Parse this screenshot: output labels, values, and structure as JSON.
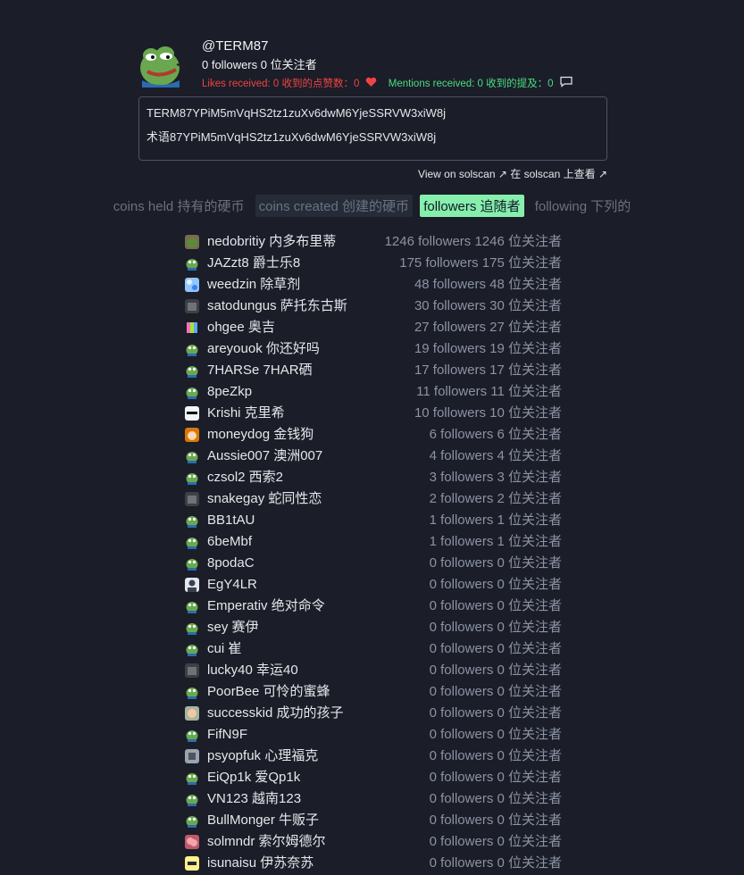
{
  "profile": {
    "handle": "@TERM87",
    "followers_text": "0 followers 0 位关注者",
    "likes_text": "Likes received: 0  收到的点赞数：0",
    "mentions_text": "Mentions received: 0  收到的提及：0",
    "address_en": "TERM87YPiM5mVqHS2tz1zuXv6dwM6YjeSSRVW3xiW8j",
    "address_cn": "术语87YPiM5mVqHS2tz1zuXv6dwM6YjeSSRVW3xiW8j",
    "solscan_text": "View on solscan ↗ 在 solscan 上查看 ↗"
  },
  "tabs": [
    {
      "label": "coins held 持有的硬币",
      "state": "inactive"
    },
    {
      "label": "coins created 创建的硬币",
      "state": "muted"
    },
    {
      "label": "followers 追随者",
      "state": "active"
    },
    {
      "label": "following 下列的",
      "state": "inactive"
    }
  ],
  "followers": [
    {
      "name": "nedobritiy  内多布里蒂",
      "count": "1246 followers 1246 位关注者",
      "icon": "pepe-photo"
    },
    {
      "name": "JAZzt8  爵士乐8",
      "count": "175 followers 175 位关注者",
      "icon": "pepe"
    },
    {
      "name": "weedzin  除草剂",
      "count": "48 followers 48 位关注者",
      "icon": "blue-pattern"
    },
    {
      "name": "satodungus  萨托东古斯",
      "count": "30 followers 30 位关注者",
      "icon": "dark-photo"
    },
    {
      "name": "ohgee  奥吉",
      "count": "27 followers 27 位关注者",
      "icon": "colorful"
    },
    {
      "name": "areyouok  你还好吗",
      "count": "19 followers 19 位关注者",
      "icon": "pepe"
    },
    {
      "name": "7HARSe  7HAR硒",
      "count": "17 followers 17 位关注者",
      "icon": "pepe"
    },
    {
      "name": "8peZkp",
      "count": "11 followers 11 位关注者",
      "icon": "pepe"
    },
    {
      "name": "Krishi  克里希",
      "count": "10 followers 10 位关注者",
      "icon": "white-face"
    },
    {
      "name": "moneydog  金钱狗",
      "count": "6 followers 6 位关注者",
      "icon": "dog"
    },
    {
      "name": "Aussie007  澳洲007",
      "count": "4 followers 4 位关注者",
      "icon": "pepe"
    },
    {
      "name": "czsol2  西索2",
      "count": "3 followers 3 位关注者",
      "icon": "pepe"
    },
    {
      "name": "snakegay  蛇同性恋",
      "count": "2 followers 2 位关注者",
      "icon": "dark-photo"
    },
    {
      "name": "BB1tAU",
      "count": "1 followers 1 位关注者",
      "icon": "pepe"
    },
    {
      "name": "6beMbf",
      "count": "1 followers 1 位关注者",
      "icon": "pepe"
    },
    {
      "name": "8podaC",
      "count": "0 followers 0 位关注者",
      "icon": "pepe"
    },
    {
      "name": "EgY4LR",
      "count": "0 followers 0 位关注者",
      "icon": "portrait"
    },
    {
      "name": "Emperativ  绝对命令",
      "count": "0 followers 0 位关注者",
      "icon": "pepe"
    },
    {
      "name": "sey  赛伊",
      "count": "0 followers 0 位关注者",
      "icon": "pepe"
    },
    {
      "name": "cui  崔",
      "count": "0 followers 0 位关注者",
      "icon": "pepe"
    },
    {
      "name": "lucky40  幸运40",
      "count": "0 followers 0 位关注者",
      "icon": "dark-photo"
    },
    {
      "name": "PoorBee  可怜的蜜蜂",
      "count": "0 followers 0 位关注者",
      "icon": "pepe"
    },
    {
      "name": "successkid  成功的孩子",
      "count": "0 followers 0 位关注者",
      "icon": "kid-photo"
    },
    {
      "name": "FifN9F",
      "count": "0 followers 0 位关注者",
      "icon": "pepe"
    },
    {
      "name": "psyopfuk  心理福克",
      "count": "0 followers 0 位关注者",
      "icon": "grey-photo"
    },
    {
      "name": "EiQp1k  爱Qp1k",
      "count": "0 followers 0 位关注者",
      "icon": "pepe"
    },
    {
      "name": "VN123  越南123",
      "count": "0 followers 0 位关注者",
      "icon": "pepe"
    },
    {
      "name": "BullMonger  牛贩子",
      "count": "0 followers 0 位关注者",
      "icon": "pepe"
    },
    {
      "name": "solmndr  索尔姆德尔",
      "count": "0 followers 0 位关注者",
      "icon": "pink-brain"
    },
    {
      "name": "isunaisu  伊苏奈苏",
      "count": "0 followers 0 位关注者",
      "icon": "yellow-text"
    }
  ]
}
